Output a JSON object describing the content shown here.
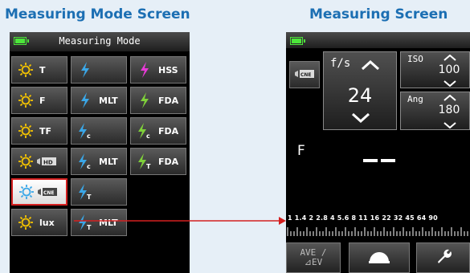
{
  "headings": {
    "left": "Measuring Mode Screen",
    "right": "Measuring Screen"
  },
  "measuring_mode": {
    "title": "Measuring Mode",
    "cells": [
      {
        "icon": "sun-icon",
        "label": "T"
      },
      {
        "icon": "flash-icon",
        "label": ""
      },
      {
        "icon": "flash-hss-icon",
        "label": "HSS"
      },
      {
        "icon": "sun-icon",
        "label": "F"
      },
      {
        "icon": "flash-icon",
        "label": "MLT"
      },
      {
        "icon": "flash-icon",
        "label": "FDA"
      },
      {
        "icon": "sun-icon",
        "label": "TF"
      },
      {
        "icon": "flash-c-icon",
        "label": ""
      },
      {
        "icon": "flash-c-icon",
        "label": "FDA"
      },
      {
        "icon": "sun-hd-video-icon",
        "label": ""
      },
      {
        "icon": "flash-c-icon",
        "label": "MLT"
      },
      {
        "icon": "flash-t-icon",
        "label": "FDA"
      },
      {
        "icon": "sun-cine-icon",
        "label": "",
        "selected": true
      },
      {
        "icon": "flash-t-icon",
        "label": ""
      },
      {
        "icon": "sun-icon",
        "label": "lux"
      },
      {
        "icon": "flash-t-icon",
        "label": "MLT"
      }
    ]
  },
  "measuring": {
    "fs_label": "f/s",
    "fs_value": "24",
    "iso_label": "ISO",
    "iso_value": "100",
    "ang_label": "Ang",
    "ang_value": "180",
    "mode_letter": "F",
    "scale_numbers": "1 1.4 2 2.8 4 5.6 8 11 16 22 32 45 64 90",
    "ave_label": "AVE /\n⊿EV"
  },
  "colors": {
    "heading": "#1c6fb3",
    "sun_icon": "#f5c400",
    "flash_icon_blue": "#3aa7e8",
    "flash_icon_green": "#7fd13a",
    "flash_icon_magenta": "#e83ad7",
    "selection_border": "#d42020",
    "arrow": "#d42020",
    "battery": "#4ce63a"
  }
}
